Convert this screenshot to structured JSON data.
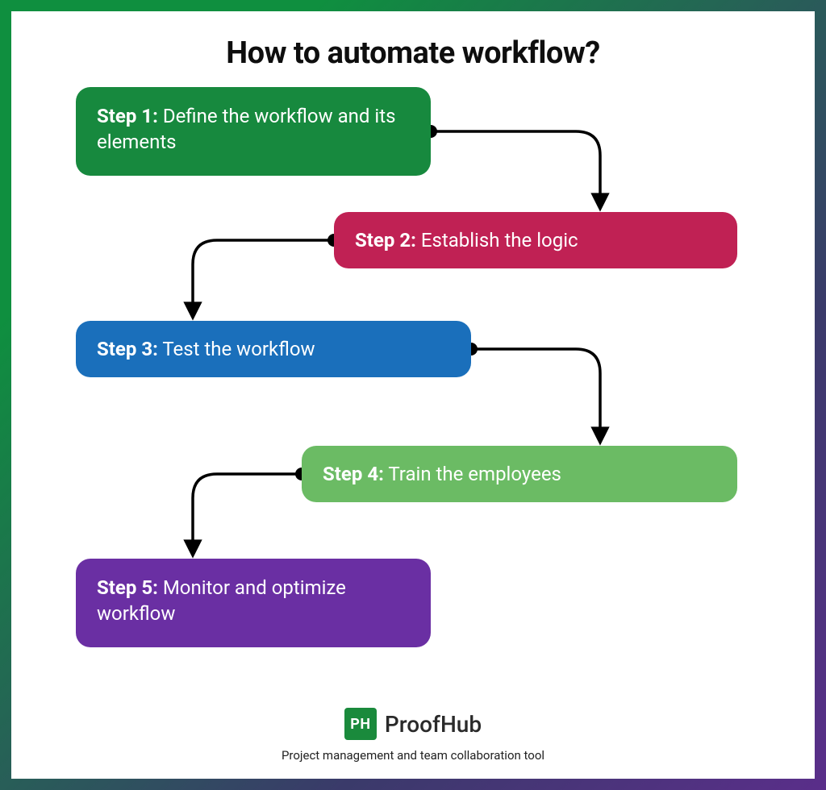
{
  "title": "How to automate workflow?",
  "steps": [
    {
      "label": "Step 1:",
      "text": "Define the workflow and its elements",
      "color": "#17893e"
    },
    {
      "label": "Step 2:",
      "text": "Establish the logic",
      "color": "#c02154"
    },
    {
      "label": "Step 3:",
      "text": "Test the workflow",
      "color": "#1a6fbb"
    },
    {
      "label": "Step 4:",
      "text": "Train the employees",
      "color": "#6bbb64"
    },
    {
      "label": "Step 5:",
      "text": "Monitor and optimize workflow",
      "color": "#6a2fa3"
    }
  ],
  "brand": {
    "logo_text": "PH",
    "name": "ProofHub",
    "tagline": "Project management and team collaboration tool"
  }
}
